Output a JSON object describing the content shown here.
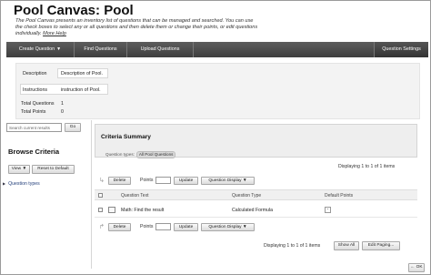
{
  "page": {
    "title": "Pool Canvas: Pool",
    "description": "The Pool Canvas presents an inventory list of questions that can be managed and searched. You can use the check boxes to select any or all questions and then delete them or change their points, or edit questions individually.",
    "more_help": "More Help"
  },
  "actionbar": {
    "create_question": "Create Question",
    "find_questions": "Find Questions",
    "upload_questions": "Upload Questions",
    "question_settings": "Question Settings"
  },
  "summary": {
    "description_label": "Description",
    "description_value": "Description of Pool.",
    "instructions_label": "Instructions",
    "instructions_value": "instruction of Pool.",
    "total_questions_label": "Total Questions",
    "total_questions_value": "1",
    "total_points_label": "Total Points",
    "total_points_value": "0"
  },
  "left": {
    "search_placeholder": "Search current results",
    "go_label": "Go",
    "browse_title": "Browse Criteria",
    "view_label": "View",
    "reset_label": "Reset to Default",
    "question_types_link": "Question types"
  },
  "criteria": {
    "title": "Criteria Summary",
    "question_types_label": "Question types:",
    "question_types_value": "All Pool Questions"
  },
  "list": {
    "displaying_top": "Displaying 1 to 1 of 1 items",
    "delete_label": "Delete",
    "points_label": "Points",
    "update_label": "Update",
    "question_display_label": "Question Display",
    "columns": [
      "Question Text",
      "Question Type",
      "Default Points"
    ],
    "rows": [
      {
        "question_text": "Math: Find the result",
        "question_type": "Calculated Formula",
        "default_points": "-"
      }
    ],
    "displaying_bottom": "Displaying 1 to 1 of 1 items",
    "show_all_label": "Show All",
    "edit_paging_label": "Edit Paging..."
  },
  "footer": {
    "ok_label": "OK"
  }
}
